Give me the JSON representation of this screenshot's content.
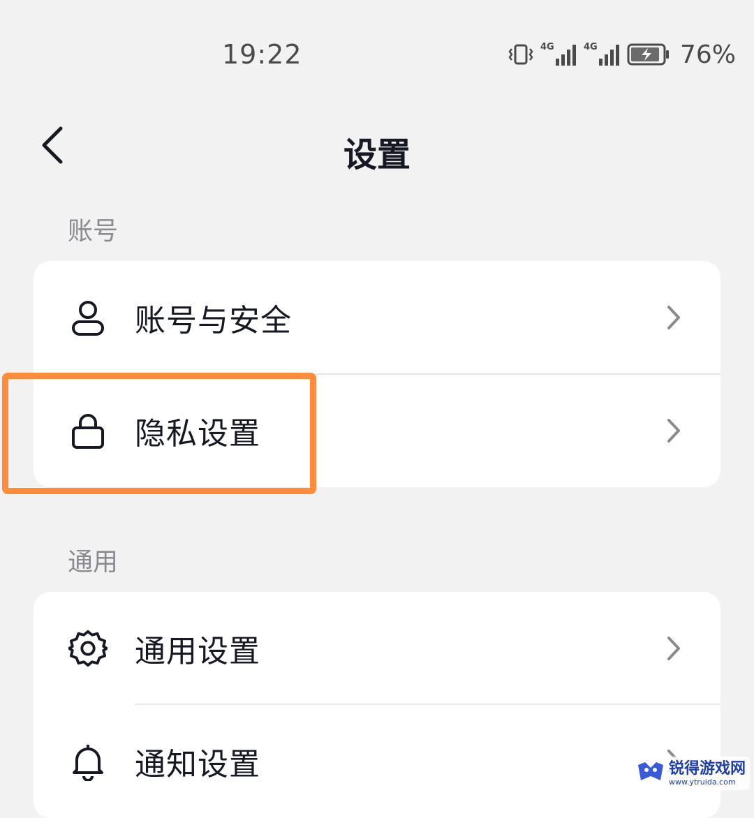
{
  "status_bar": {
    "time": "19:22",
    "network_1": "4G",
    "network_2": "4G",
    "battery_percent": "76%",
    "icons": [
      "vibrate-icon",
      "signal-icon",
      "signal-icon",
      "battery-charging-icon"
    ]
  },
  "nav": {
    "title": "设置",
    "back_icon": "back-arrow-icon"
  },
  "sections": [
    {
      "label": "账号",
      "items": [
        {
          "label": "账号与安全",
          "icon": "user-icon"
        },
        {
          "label": "隐私设置",
          "icon": "lock-icon"
        }
      ]
    },
    {
      "label": "通用",
      "items": [
        {
          "label": "通用设置",
          "icon": "gear-icon"
        },
        {
          "label": "通知设置",
          "icon": "bell-icon"
        }
      ]
    }
  ],
  "highlight": {
    "target": "隐私设置",
    "color": "#ff8c3a"
  },
  "watermark": {
    "title": "锐得游戏网",
    "url": "www.ytruida.com"
  },
  "colors": {
    "background": "#f2f2f2",
    "card": "#ffffff",
    "text_primary": "#161823",
    "text_secondary": "#8a8b91"
  }
}
